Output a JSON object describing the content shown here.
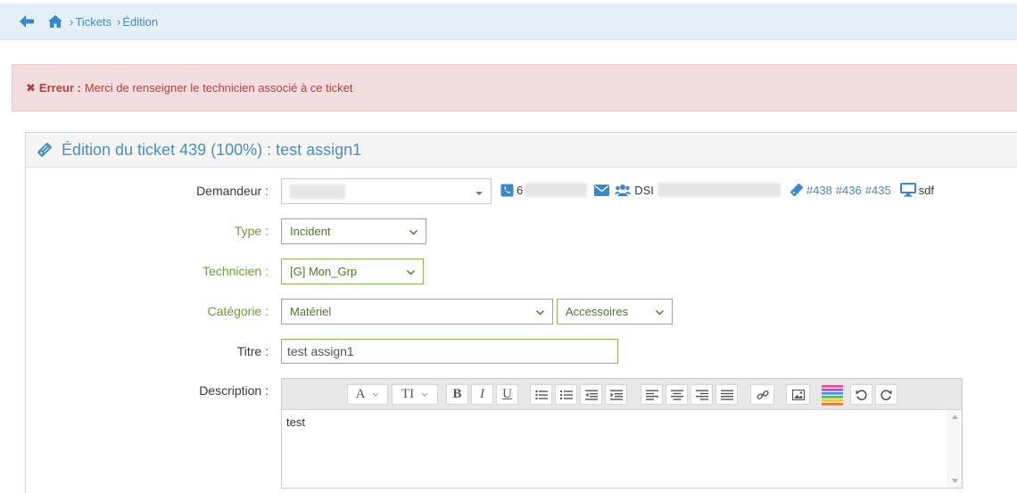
{
  "breadcrumb": {
    "separator": "›",
    "items": [
      "Tickets",
      "Édition"
    ]
  },
  "alert": {
    "x": "✖",
    "title": "Erreur :",
    "message": "Merci de renseigner le technicien associé à ce ticket"
  },
  "panel": {
    "title": "Édition du ticket 439 (100%) : test assign1"
  },
  "form": {
    "demandeur_label": "Demandeur :",
    "demandeur_phone_prefix": "6",
    "demandeur_service": "DSI",
    "demandeur_tickets": [
      "#438",
      "#436",
      "#435"
    ],
    "demandeur_asset": "sdf",
    "type_label": "Type :",
    "type_value": "Incident",
    "technicien_label": "Technicien :",
    "technicien_value": "[G] Mon_Grp",
    "categorie_label": "Catégorie :",
    "categorie_value": "Matériel",
    "souscategorie_value": "Accessoires",
    "titre_label": "Titre :",
    "titre_value": "test assign1",
    "description_label": "Description :",
    "description_value": "test"
  },
  "toolbar": {
    "font": "A",
    "textsize": "TI",
    "bold": "B",
    "italic": "I",
    "underline": "U"
  },
  "colors": {
    "accent": "#4c8fbd",
    "green": "#8bbd55",
    "alert_bg": "#f2dede",
    "alert_text": "#a94442"
  }
}
